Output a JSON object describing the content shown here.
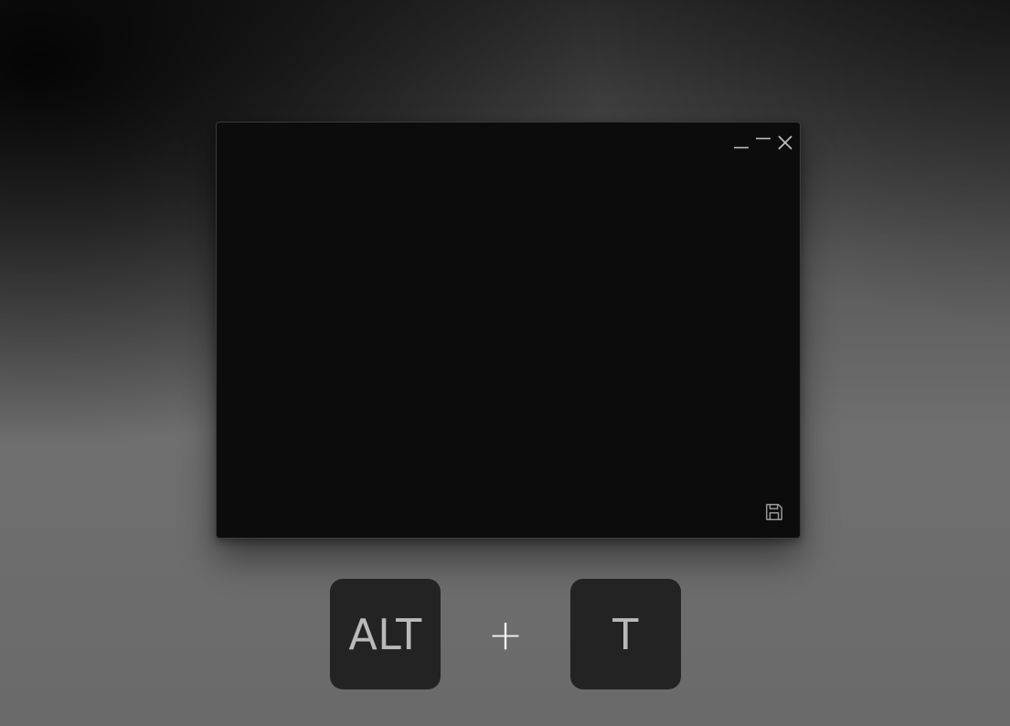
{
  "window": {
    "controls": [
      {
        "name": "collapse",
        "icon": "collapse-icon"
      },
      {
        "name": "minimize",
        "icon": "minimize-icon"
      },
      {
        "name": "close",
        "icon": "close-icon"
      }
    ],
    "save_icon": "save-icon",
    "content": ""
  },
  "shortcut": {
    "keys": [
      "ALT",
      "T"
    ],
    "separator": "+"
  },
  "colors": {
    "window_bg": "#0c0c0d",
    "key_bg": "#232323",
    "key_text": "#b9b9b9",
    "icon": "#bdbdbd"
  }
}
